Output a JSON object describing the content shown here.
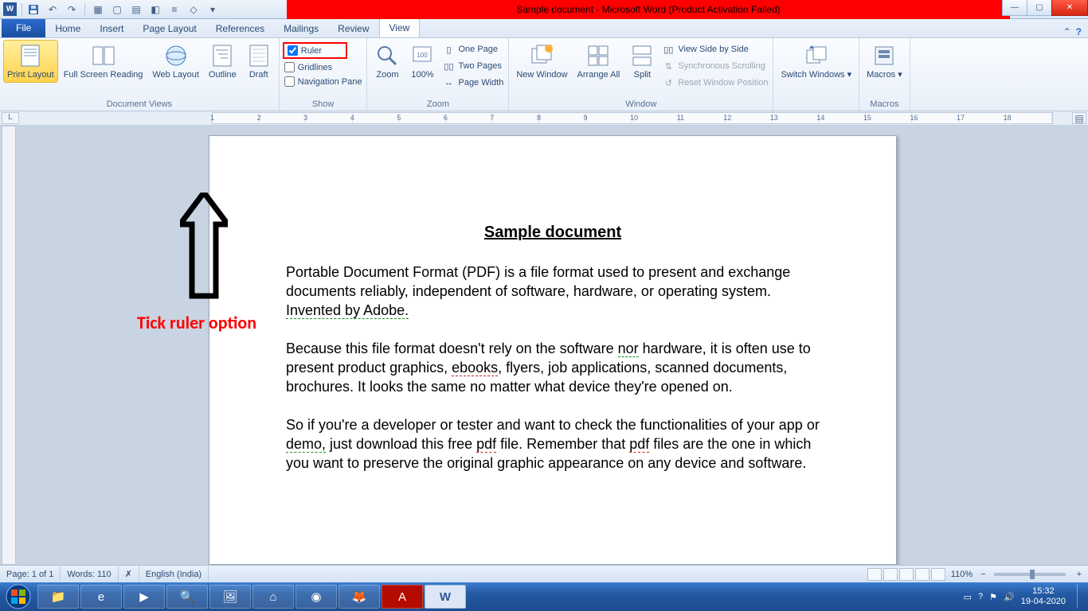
{
  "title_bar": {
    "title": "Sample document  -  Microsoft Word (Product Activation Failed)"
  },
  "tabs": {
    "file": "File",
    "items": [
      "Home",
      "Insert",
      "Page Layout",
      "References",
      "Mailings",
      "Review",
      "View"
    ],
    "active_index": 6
  },
  "ribbon": {
    "document_views": {
      "label": "Document Views",
      "print_layout": "Print Layout",
      "full_screen": "Full Screen Reading",
      "web_layout": "Web Layout",
      "outline": "Outline",
      "draft": "Draft"
    },
    "show": {
      "label": "Show",
      "ruler": "Ruler",
      "gridlines": "Gridlines",
      "nav_pane": "Navigation Pane",
      "ruler_checked": true
    },
    "zoom": {
      "label": "Zoom",
      "zoom_btn": "Zoom",
      "hundred": "100%",
      "one_page": "One Page",
      "two_pages": "Two Pages",
      "page_width": "Page Width"
    },
    "window": {
      "label": "Window",
      "new_window": "New Window",
      "arrange_all": "Arrange All",
      "split": "Split",
      "side_by_side": "View Side by Side",
      "sync_scroll": "Synchronous Scrolling",
      "reset_pos": "Reset Window Position"
    },
    "switch_windows": "Switch Windows ▾",
    "macros": {
      "label": "Macros",
      "btn": "Macros ▾"
    }
  },
  "document": {
    "title": "Sample document",
    "p1a": "Portable Document Format (PDF) is a file format used to present and exchange documents",
    "p1b": " reliably, independent of software, hardware, or operating system. ",
    "p1c": "Invented by Adobe.",
    "p2a": "Because this file format doesn't rely on the software ",
    "p2_nor": "nor",
    "p2b": " hardware, it is often use to present product graphics, ",
    "p2_ebooks": "ebooks",
    "p2c": ", flyers, job applications, scanned documents, brochures. It looks the same no matter what device they're opened on.",
    "p3a": "So if you're a developer or tester and want to check the functionalities of your app or ",
    "p3_demo": "demo,",
    "p3b": " just download this free ",
    "p3_pdf1": "pdf",
    "p3c": " file. Remember that ",
    "p3_pdf2": "pdf",
    "p3d": " files are the one in which you want to preserve the original graphic appearance on any device and software."
  },
  "annotation": "Tick ruler option",
  "status": {
    "page": "Page: 1 of 1",
    "words": "Words: 110",
    "language": "English (India)",
    "zoom": "110%"
  },
  "tray": {
    "time": "15:32",
    "date": "19-04-2020"
  }
}
